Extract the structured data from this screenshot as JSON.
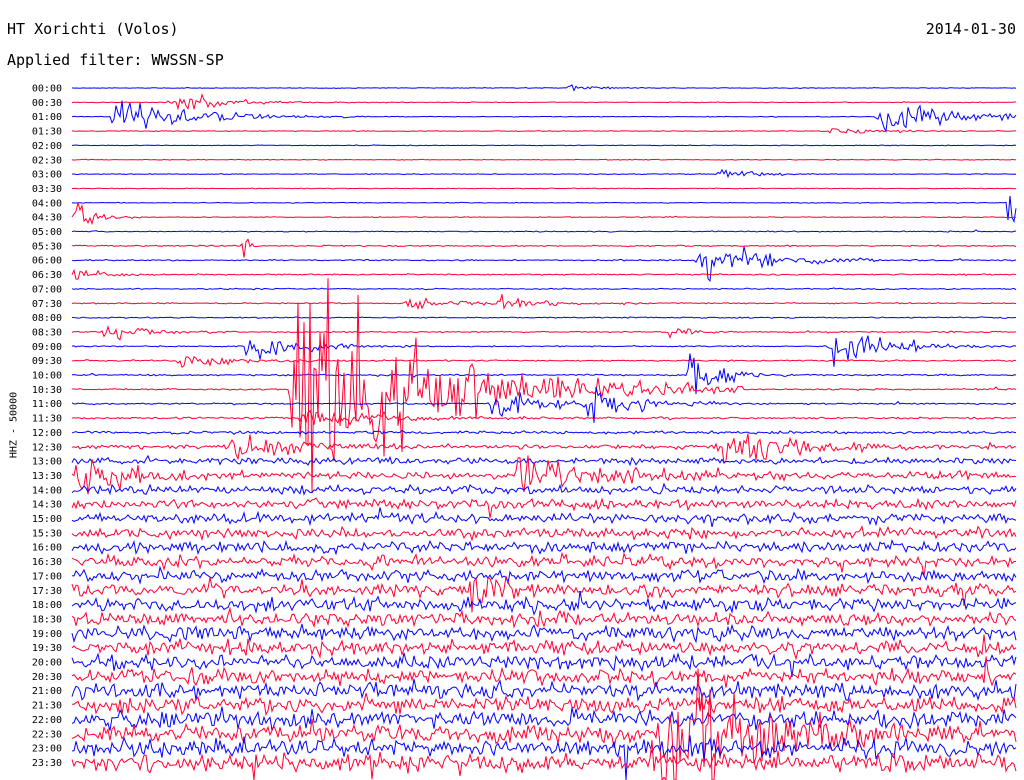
{
  "header": {
    "station": "HT Xorichti (Volos)",
    "date": "2014-01-30",
    "filter_label": "Applied filter:",
    "filter": "WWSSN-SP"
  },
  "channel": "HHZ - 50000",
  "chart_data": {
    "type": "line",
    "title": "HT Xorichti (Volos)",
    "subtitle": "Applied filter: WWSSN-SP",
    "ylabel": "HHZ - 50000",
    "xlabel": "",
    "row_labels": [
      "00:00",
      "00:30",
      "01:00",
      "01:30",
      "02:00",
      "02:30",
      "03:00",
      "03:30",
      "04:00",
      "04:30",
      "05:00",
      "05:30",
      "06:00",
      "06:30",
      "07:00",
      "07:30",
      "08:00",
      "08:30",
      "09:00",
      "09:30",
      "10:00",
      "10:30",
      "11:00",
      "11:30",
      "12:00",
      "12:30",
      "13:00",
      "13:30",
      "14:00",
      "14:30",
      "15:00",
      "15:30",
      "16:00",
      "16:30",
      "17:00",
      "17:30",
      "18:00",
      "18:30",
      "19:00",
      "19:30",
      "20:00",
      "20:30",
      "21:00",
      "21:30",
      "22:00",
      "22:30",
      "23:00",
      "23:30"
    ],
    "series_colors": [
      "#0000ff",
      "#ff0033"
    ],
    "noise_levels": [
      0.3,
      0.3,
      0.3,
      0.3,
      0.3,
      0.3,
      0.3,
      0.3,
      0.3,
      0.3,
      0.4,
      0.5,
      0.5,
      0.5,
      0.5,
      0.5,
      0.5,
      0.5,
      0.5,
      0.6,
      0.6,
      0.6,
      0.6,
      0.8,
      1.2,
      1.6,
      2.4,
      3.0,
      3.4,
      3.6,
      3.8,
      4.0,
      4.2,
      4.4,
      4.6,
      4.8,
      5.0,
      5.2,
      5.4,
      5.6,
      5.8,
      6.0,
      6.2,
      6.4,
      6.6,
      6.8,
      7.0,
      7.2
    ],
    "events": [
      {
        "row": 0,
        "x": 0.52,
        "amp": 3,
        "dur": 0.03
      },
      {
        "row": 1,
        "x": 0.1,
        "amp": 4,
        "dur": 0.04
      },
      {
        "row": 1,
        "x": 0.11,
        "amp": 5,
        "dur": 0.05
      },
      {
        "row": 2,
        "x": 0.04,
        "amp": 16,
        "dur": 0.07
      },
      {
        "row": 2,
        "x": 0.85,
        "amp": 14,
        "dur": 0.07
      },
      {
        "row": 3,
        "x": 0.8,
        "amp": 3,
        "dur": 0.04
      },
      {
        "row": 6,
        "x": 0.68,
        "amp": 6,
        "dur": 0.03
      },
      {
        "row": 9,
        "x": 0.0,
        "amp": 12,
        "dur": 0.02
      },
      {
        "row": 8,
        "x": 0.99,
        "amp": 40,
        "dur": 0.01
      },
      {
        "row": 11,
        "x": 0.18,
        "amp": 20,
        "dur": 0.005
      },
      {
        "row": 12,
        "x": 0.66,
        "amp": 18,
        "dur": 0.06
      },
      {
        "row": 13,
        "x": 0.0,
        "amp": 6,
        "dur": 0.03
      },
      {
        "row": 15,
        "x": 0.35,
        "amp": 5,
        "dur": 0.05
      },
      {
        "row": 15,
        "x": 0.45,
        "amp": 5,
        "dur": 0.04
      },
      {
        "row": 17,
        "x": 0.03,
        "amp": 6,
        "dur": 0.04
      },
      {
        "row": 17,
        "x": 0.63,
        "amp": 7,
        "dur": 0.02
      },
      {
        "row": 18,
        "x": 0.18,
        "amp": 12,
        "dur": 0.05
      },
      {
        "row": 18,
        "x": 0.8,
        "amp": 16,
        "dur": 0.05
      },
      {
        "row": 19,
        "x": 0.11,
        "amp": 8,
        "dur": 0.04
      },
      {
        "row": 20,
        "x": 0.65,
        "amp": 18,
        "dur": 0.03
      },
      {
        "row": 21,
        "x": 0.23,
        "amp": 110,
        "dur": 0.12
      },
      {
        "row": 22,
        "x": 0.44,
        "amp": 14,
        "dur": 0.05
      },
      {
        "row": 22,
        "x": 0.54,
        "amp": 14,
        "dur": 0.05
      },
      {
        "row": 23,
        "x": 0.24,
        "amp": 10,
        "dur": 0.06
      },
      {
        "row": 25,
        "x": 0.16,
        "amp": 12,
        "dur": 0.06
      },
      {
        "row": 25,
        "x": 0.68,
        "amp": 22,
        "dur": 0.06
      },
      {
        "row": 27,
        "x": 0.0,
        "amp": 18,
        "dur": 0.05
      },
      {
        "row": 27,
        "x": 0.47,
        "amp": 22,
        "dur": 0.06
      },
      {
        "row": 35,
        "x": 0.42,
        "amp": 18,
        "dur": 0.03
      },
      {
        "row": 45,
        "x": 0.62,
        "amp": 80,
        "dur": 0.07
      }
    ]
  }
}
